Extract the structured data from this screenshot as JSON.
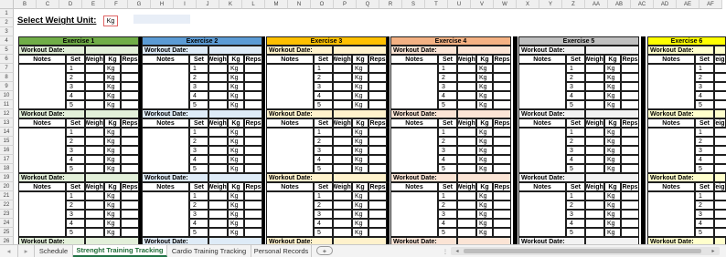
{
  "unit": {
    "label": "Select Weight Unit:",
    "value": "Kg"
  },
  "col_letters": [
    "B",
    "C",
    "D",
    "E",
    "F",
    "G",
    "H",
    "I",
    "J",
    "K",
    "L",
    "M",
    "N",
    "O",
    "P",
    "Q",
    "R",
    "S",
    "T",
    "U",
    "V",
    "W",
    "X",
    "Y",
    "Z",
    "AA",
    "AB",
    "AC",
    "AD",
    "AE",
    "AF"
  ],
  "row_numbers": [
    "1",
    "2",
    "3",
    "4",
    "5",
    "6",
    "7",
    "8",
    "9",
    "10",
    "11",
    "12",
    "13",
    "14",
    "15",
    "16",
    "17",
    "18",
    "19",
    "20",
    "21",
    "22",
    "23",
    "24",
    "25",
    "26"
  ],
  "exercises": [
    {
      "name": "Exercise 1",
      "color": "#70ad47",
      "light": "#e2efd9"
    },
    {
      "name": "Exercise 2",
      "color": "#5b9bd5",
      "light": "#deebf7"
    },
    {
      "name": "Exercise 3",
      "color": "#ffc000",
      "light": "#fff2cc"
    },
    {
      "name": "Exercise 4",
      "color": "#f4b183",
      "light": "#fbe4d5"
    },
    {
      "name": "Exercise 5",
      "color": "#bfbfbf",
      "light": "#f2f2f2"
    },
    {
      "name": "Exercise 6",
      "color": "#ffff00",
      "light": "#ffffcc"
    }
  ],
  "labels": {
    "workout_date": "Workout Date:",
    "notes": "Notes",
    "set": "Set",
    "weight": "Weight",
    "unit": "Kg",
    "reps": "Reps"
  },
  "sets": [
    "1",
    "2",
    "3",
    "4",
    "5"
  ],
  "tabs": [
    "Schedule",
    "Strenght Training Tracking",
    "Cardio Training Tracking",
    "Personal Records"
  ],
  "active_tab": "Strenght Training Tracking",
  "add_sheet": "+"
}
